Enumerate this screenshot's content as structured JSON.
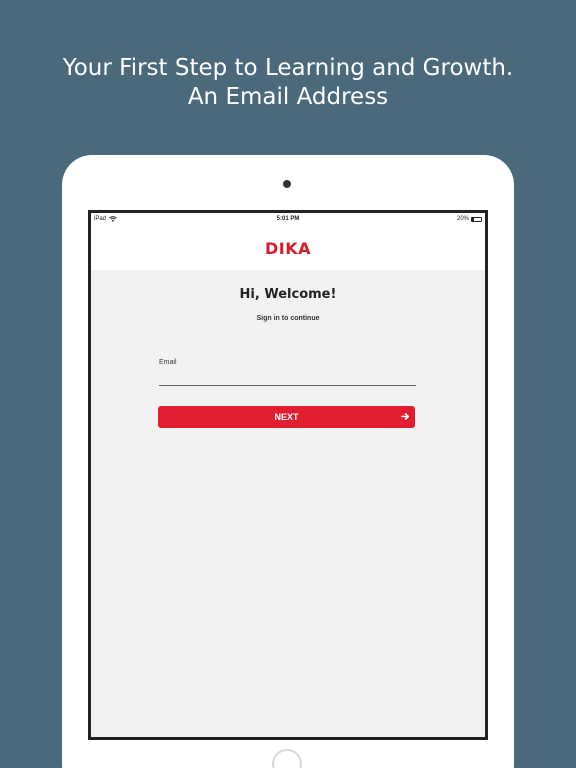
{
  "headline": {
    "line1": "Your First Step to Learning and Growth.",
    "line2": "An Email Address"
  },
  "statusbar": {
    "device": "iPad",
    "time": "5:01 PM",
    "battery": "20%"
  },
  "app": {
    "logo": "DIKA",
    "brand_color": "#d91c2c"
  },
  "login": {
    "title": "Hi, Welcome!",
    "subtitle": "Sign in to continue",
    "email_label": "Email",
    "email_value": "",
    "next_label": "NEXT"
  },
  "icons": {
    "wifi": "wifi-icon",
    "battery": "battery-icon",
    "next_arrow": "arrow-right-icon"
  },
  "colors": {
    "background": "#4a6a7c",
    "button": "#e01e30",
    "screen_bg": "#f2f2f2"
  }
}
